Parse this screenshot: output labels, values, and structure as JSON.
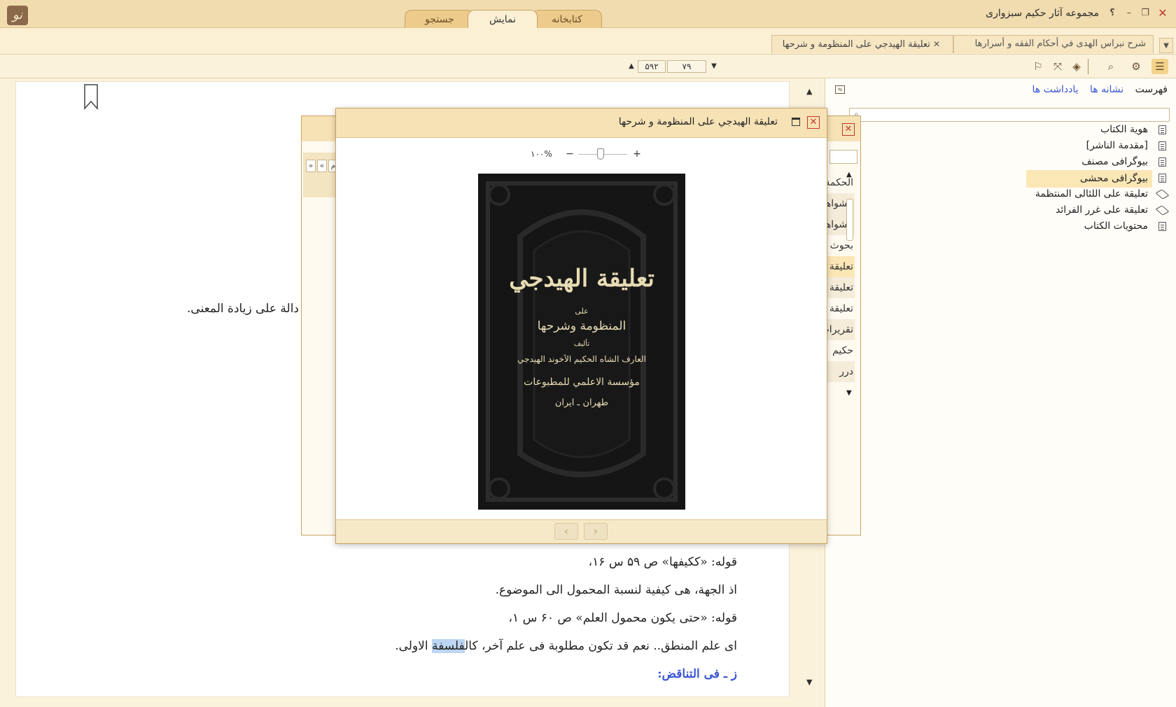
{
  "window": {
    "title": "مجموعه آثار حکیم سبزواری",
    "logo_glyph": "نو",
    "help_glyph": "؟",
    "min_glyph": "–",
    "max_glyph": "❐",
    "close_glyph": "✕"
  },
  "main_tabs": [
    {
      "label": "کتابخانه"
    },
    {
      "label": "نمایش"
    },
    {
      "label": "جستجو"
    }
  ],
  "doc_tabs": [
    {
      "label": "شرح نبراس الهدى في أحكام الفقه و أسرارها"
    },
    {
      "label": "تعليقة الهيدجي على المنظومة و شرحها",
      "close": "✕"
    }
  ],
  "toolbar": {
    "icons": [
      "list-icon",
      "gear-icon",
      "search-icon",
      "book-icon",
      "fullscreen-icon",
      "bookmark-icon"
    ],
    "page_current": "۷۹",
    "page_total": "۵۹۲",
    "up_arrow": "▲",
    "down_arrow": "▼"
  },
  "page": {
    "lines": [
      {
        "text": "دالة على زيادة المعنى."
      },
      {
        "text": "قوله: «ككيفها» ص ۵۹ س ۱۶،"
      },
      {
        "text": "اذ الجهة، هى كيفية لنسبة المحمول الى الموضوع."
      },
      {
        "text": "قوله: «حتى يكون محمول العلم» ص ۶۰ س ۱،"
      },
      {
        "pre": "اى علم المنطق.. نعم قد تكون مطلوبة فى علم آخر، كال",
        "highlight": "فلسفة",
        "post": " الاولى."
      },
      {
        "text": "ز ـ فى التناقض:"
      }
    ]
  },
  "right_panel": {
    "tabs": [
      {
        "label": "فهرست"
      },
      {
        "label": "نشانه ها"
      },
      {
        "label": "يادداشت ها"
      }
    ],
    "toc": [
      {
        "label": "هوية الكتاب",
        "icon": "page-icon"
      },
      {
        "label": "[مقدمة الناشر]",
        "icon": "page-icon"
      },
      {
        "label": "بیوگرافی مصنف",
        "icon": "page-icon"
      },
      {
        "label": "بیوگرافی محشی",
        "icon": "page-icon",
        "selected": true
      },
      {
        "label": "تعليقة على اللئالى المنتظمة",
        "icon": "book-icon"
      },
      {
        "label": "تعليقة على غرر الفرائد",
        "icon": "book-icon"
      },
      {
        "label": "محتويات الكتاب",
        "icon": "page-icon"
      }
    ]
  },
  "bg_dialog": {
    "list": [
      "الحكمة",
      "الشواهد",
      "الشواهد",
      "بحوث",
      "تعليقة",
      "تعليقة",
      "تعليقة",
      "تقريرات",
      "حكيم",
      "درر"
    ],
    "nav": [
      "»",
      "«",
      "م"
    ]
  },
  "viewer": {
    "title": "تعليقة الهيدجي على المنظومة و شرحها",
    "zoom_label": "۱۰۰%",
    "zoom_in": "+",
    "zoom_out": "−",
    "prev": "‹",
    "next": "›",
    "cover": {
      "title": "تعليقة الهيدجي",
      "line2": "على",
      "line3": "المنظومة وشرحها",
      "line4": "تأليف",
      "line5": "العارف الشاه الحكيم الآخوند الهيدجي",
      "line6": "مؤسسة الاعلمي للمطبوعات",
      "line7": "طهران ـ ايران"
    }
  }
}
